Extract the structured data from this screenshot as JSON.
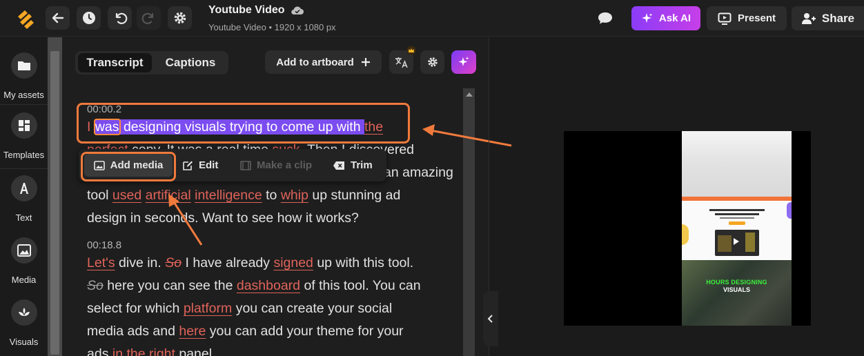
{
  "header": {
    "doc_title": "Youtube Video",
    "doc_subtitle": "Youtube Video • 1920 x 1080 px",
    "ask_ai_label": "Ask AI",
    "present_label": "Present",
    "share_label": "Share",
    "accent": "#8b3cf7"
  },
  "rail": {
    "items": [
      {
        "label": "My assets",
        "icon": "folder-icon"
      },
      {
        "label": "Templates",
        "icon": "templates-icon"
      },
      {
        "label": "Text",
        "icon": "text-icon"
      },
      {
        "label": "Media",
        "icon": "image-icon"
      },
      {
        "label": "Visuals",
        "icon": "visuals-icon"
      }
    ]
  },
  "panel": {
    "tabs": [
      "Transcript",
      "Captions"
    ],
    "active_tab": "Transcript",
    "add_artboard_label": "Add to artboard"
  },
  "transcript": {
    "segment1": {
      "time": "00:00.2",
      "line1": {
        "w1": "I",
        "w2": "was",
        "w3": "designing visuals trying to come up with",
        "w4": "the"
      },
      "line2": {
        "w1": "perfect",
        "w2": "copy. It was a real time",
        "w3": "suck",
        "w4": ". Then I discovered"
      },
      "line3": {
        "w1": "an",
        "w2": "amazing"
      },
      "line4": {
        "w1": "tool",
        "w2": "used",
        "w3": "artificial",
        "w4": "intelligence",
        "w5": "to",
        "w6": "whip",
        "w7": "up stunning ad"
      },
      "line5": "design in seconds. Want to see how it works?"
    },
    "segment2": {
      "time": "00:18.8",
      "line1": {
        "w1": "Let's",
        "w2": "dive in.",
        "w3": "So",
        "w4": "I have already",
        "w5": "signed",
        "w6": "up with this tool."
      },
      "line2": {
        "w1": "So",
        "w2": "here you can see the",
        "w3": "dashboard",
        "w4": "of this tool. You can"
      },
      "line3": {
        "w1": "select for which",
        "w2": "platform",
        "w3": "you can create your social"
      },
      "line4": {
        "w1": "media ads and",
        "w2": "here",
        "w3": "you can add your theme for your"
      },
      "line5": {
        "w1": "ads",
        "w2": "in the",
        "w3": "right",
        "w4": "panel."
      }
    }
  },
  "popup": {
    "add_media_label": "Add media",
    "edit_label": "Edit",
    "make_clip_label": "Make a clip",
    "trim_label": "Trim"
  },
  "preview": {
    "caption_line1": "HOURS DESIGNING",
    "caption_line2": "VISUALS"
  }
}
